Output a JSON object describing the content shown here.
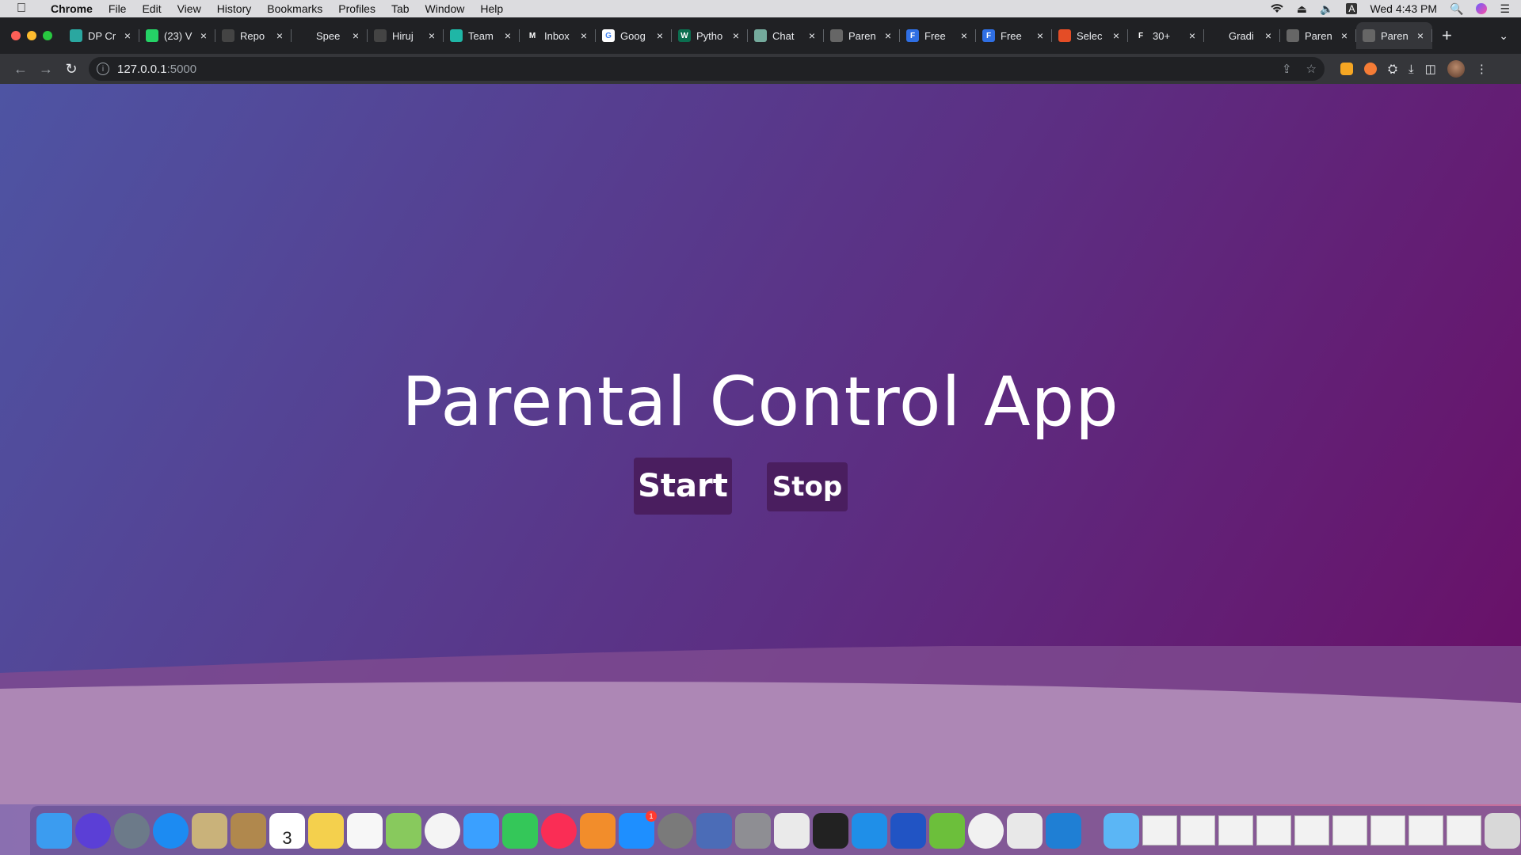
{
  "menubar": {
    "app_name": "Chrome",
    "items": [
      "File",
      "Edit",
      "View",
      "History",
      "Bookmarks",
      "Profiles",
      "Tab",
      "Window",
      "Help"
    ],
    "clock": "Wed 4:43 PM",
    "input_indicator": "A"
  },
  "tabs": [
    {
      "title": "DP Cr",
      "color": "#2aa7a0",
      "fav_text": ""
    },
    {
      "title": "(23) V",
      "color": "#25d366",
      "fav_text": ""
    },
    {
      "title": "Repo",
      "color": "#444",
      "fav_text": ""
    },
    {
      "title": "Spee",
      "color": "#202124",
      "fav_text": ""
    },
    {
      "title": "Hiruj",
      "color": "#444",
      "fav_text": ""
    },
    {
      "title": "Team",
      "color": "#1fb6a6",
      "fav_text": ""
    },
    {
      "title": "Inbox",
      "color": "#202124",
      "fav_text": "M"
    },
    {
      "title": "Goog",
      "color": "#ffffff",
      "fav_text": "G"
    },
    {
      "title": "Pytho",
      "color": "#0b6e4f",
      "fav_text": "W"
    },
    {
      "title": "Chat",
      "color": "#74aa9c",
      "fav_text": ""
    },
    {
      "title": "Paren",
      "color": "#666",
      "fav_text": ""
    },
    {
      "title": "Free",
      "color": "#2f6fe4",
      "fav_text": "F"
    },
    {
      "title": "Free",
      "color": "#2f6fe4",
      "fav_text": "F"
    },
    {
      "title": "Selec",
      "color": "#e44d26",
      "fav_text": ""
    },
    {
      "title": "30+",
      "color": "#202124",
      "fav_text": "F"
    },
    {
      "title": "Gradi",
      "color": "#202124",
      "fav_text": ""
    },
    {
      "title": "Paren",
      "color": "#666",
      "fav_text": ""
    },
    {
      "title": "Paren",
      "color": "#666",
      "fav_text": ""
    }
  ],
  "omnibox": {
    "host": "127.0.0.1",
    "port": ":5000"
  },
  "page": {
    "title": "Parental Control App",
    "start_label": "Start",
    "stop_label": "Stop",
    "colors": {
      "gradient_start": "#4e54a3",
      "gradient_end": "#6a0e66",
      "button_bg": "#4a1e5f"
    }
  },
  "dock": {
    "calendar_day": "3",
    "appstore_badge": "1",
    "icons": [
      "finder-icon",
      "siri-icon",
      "launchpad-icon",
      "safari-icon",
      "mail-icon",
      "contacts-icon",
      "calendar-icon",
      "notes-icon",
      "reminders-icon",
      "maps-icon",
      "photos-icon",
      "messages-icon",
      "facetime-icon",
      "music-icon",
      "books-icon",
      "appstore-icon",
      "system-preferences-icon",
      "keynote-icon",
      "script-editor-icon",
      "textedit-icon",
      "imovie-icon",
      "xcode-icon",
      "notability-icon",
      "bluestacks-icon",
      "chrome-icon",
      "textedit-2-icon",
      "vscode-icon"
    ]
  }
}
